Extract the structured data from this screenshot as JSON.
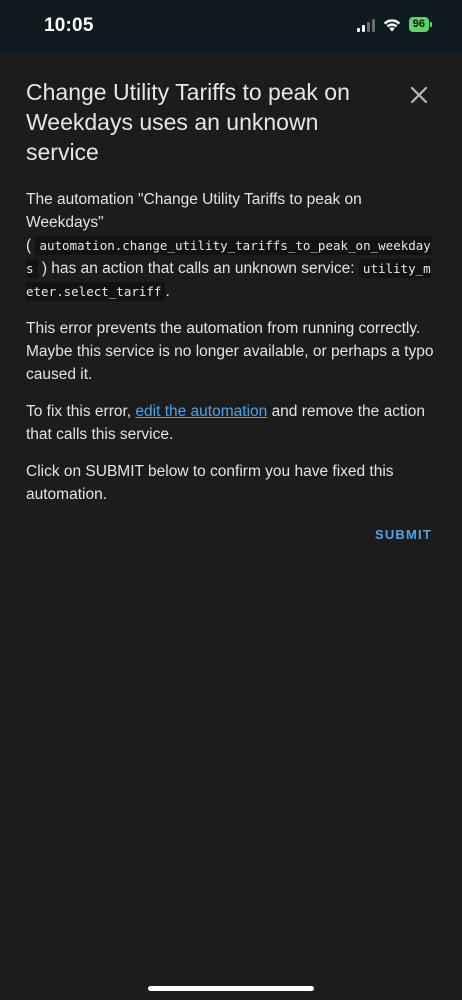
{
  "status_bar": {
    "time": "10:05",
    "battery": "96"
  },
  "dialog": {
    "title": "Change Utility Tariffs to peak on Weekdays uses an unknown service",
    "p1_part1": "The automation \"Change Utility Tariffs to peak on Weekdays\"",
    "p1_open": "(",
    "entity_id": "automation.change_utility_tariffs_to_peak_on_weekdays",
    "p1_part2": ") has an action that calls an unknown service:",
    "service": "utility_meter.select_tariff",
    "p1_end": ".",
    "p2": "This error prevents the automation from running correctly. Maybe this service is no longer available, or perhaps a typo caused it.",
    "p3_before": "To fix this error,",
    "p3_link": "edit the automation",
    "p3_after": "and remove the action that calls this service.",
    "p4": "Click on SUBMIT below to confirm you have fixed this automation.",
    "submit_label": "SUBMIT"
  }
}
